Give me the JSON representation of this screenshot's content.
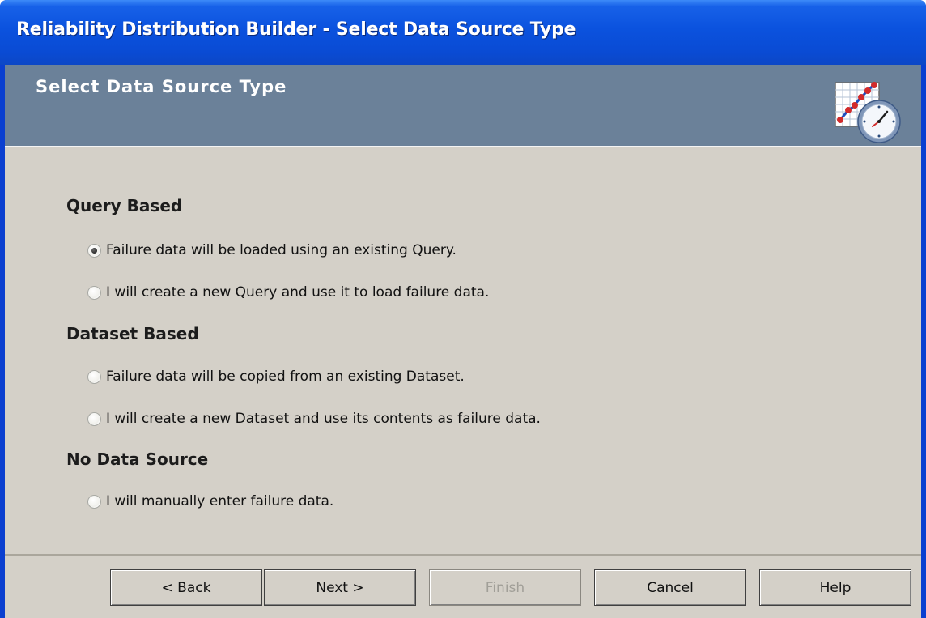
{
  "window": {
    "title": "Reliability Distribution Builder - Select Data Source Type"
  },
  "header": {
    "title": "Select Data Source Type",
    "icon": "distribution-clock-icon"
  },
  "sections": [
    {
      "title": "Query Based",
      "options": [
        {
          "label": "Failure data will be loaded using an existing Query.",
          "checked": true
        },
        {
          "label": "I will create a new Query and use it to load failure data.",
          "checked": false
        }
      ]
    },
    {
      "title": "Dataset Based",
      "options": [
        {
          "label": "Failure data will be copied from an existing Dataset.",
          "checked": false
        },
        {
          "label": "I will create a new Dataset and use its contents as failure data.",
          "checked": false
        }
      ]
    },
    {
      "title": "No Data Source",
      "options": [
        {
          "label": "I will manually enter failure data.",
          "checked": false
        }
      ]
    }
  ],
  "buttons": {
    "back": "< Back",
    "next": "Next >",
    "finish": "Finish",
    "cancel": "Cancel",
    "help": "Help"
  },
  "colors": {
    "titlebar": "#0a4bd4",
    "header": "#6b8199",
    "dialog": "#d4d0c8"
  }
}
